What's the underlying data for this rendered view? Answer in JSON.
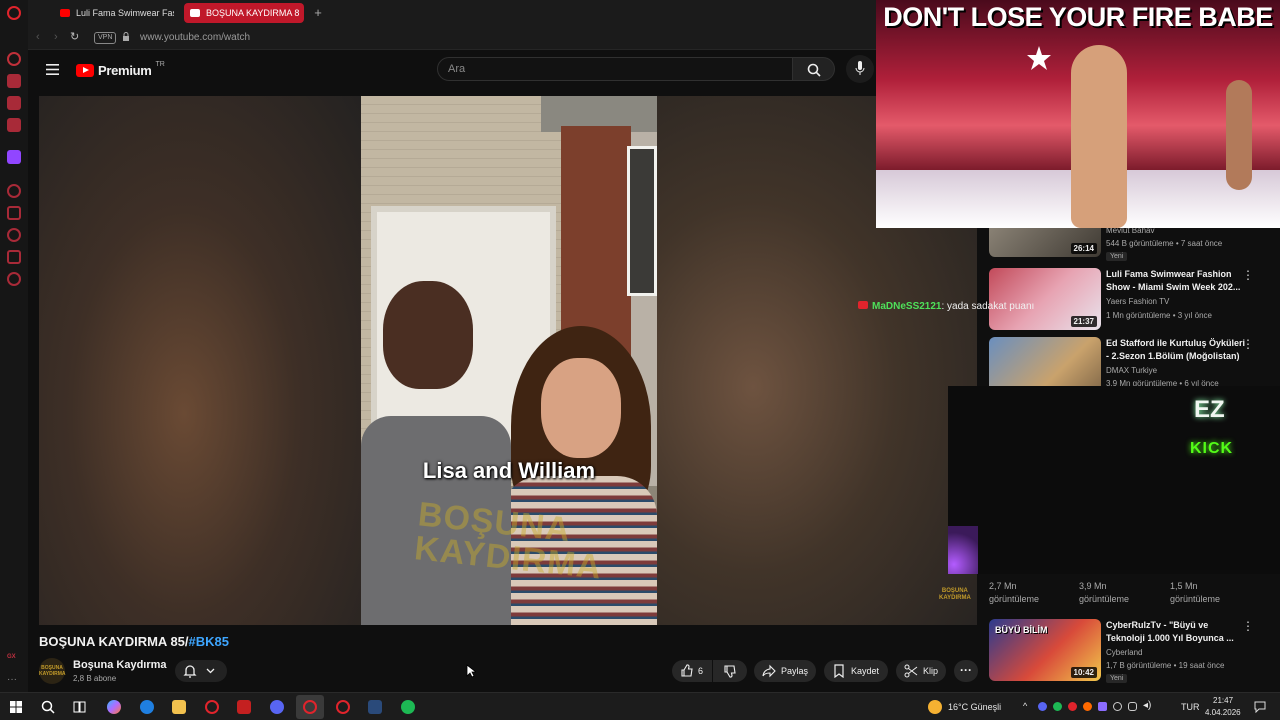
{
  "browser": {
    "tabs": [
      {
        "label": "Luli Fama Swimwear Fash"
      },
      {
        "label": "BOŞUNA KAYDIRMA 8"
      }
    ],
    "vpn_label": "VPN",
    "url": "www.youtube.com/watch"
  },
  "youtube": {
    "logo_text": "Premium",
    "logo_country": "TR",
    "search_placeholder": "Ara"
  },
  "video": {
    "caption": "Lisa and William",
    "watermark": "BOŞUNA KAYDIRMA",
    "title": "BOŞUNA KAYDIRMA 85/",
    "title_tag": "#BK85",
    "channel_name": "Boşuna Kaydırma",
    "channel_subs": "2,8 B abone",
    "channel_avatar_text": "BOŞUNA KAYDIRMA",
    "like_count": "6",
    "share_label": "Paylaş",
    "save_label": "Kaydet",
    "clip_label": "Klip"
  },
  "overlay": {
    "headline": "DON'T LOSE YOUR FIRE BABE",
    "kick_top": "EZ",
    "kick_bottom": "KICK",
    "chat_user": "MaDNeSS2121",
    "chat_text": ": yada sadakat puanı"
  },
  "recommendations": [
    {
      "duration": "26:14",
      "channel": "Mevlüt Bahav",
      "meta": "544 B görüntüleme • 7 saat önce",
      "badge": "Yeni"
    },
    {
      "title": "Luli Fama Swimwear Fashion Show - Miami Swim Week 202...",
      "duration": "21:37",
      "channel": "Yaers Fashion TV",
      "meta": "1 Mn görüntüleme • 3 yıl önce"
    },
    {
      "title": "Ed Stafford ile Kurtuluş Öyküleri - 2.Sezon 1.Bölüm (Moğolistan)",
      "channel": "DMAX Turkiye",
      "meta": "3,9 Mn görüntüleme • 6 yıl önce"
    },
    {
      "title": "CyberRulzTv - \"Büyü ve Teknoloji 1.000 Yıl Boyunca ...",
      "duration": "10:42",
      "channel": "Cyberland",
      "meta": "1,7 B görüntüleme • 19 saat önce",
      "badge": "Yeni",
      "thumb_text": "BÜYÜ BİLİM"
    }
  ],
  "shorts_stats": [
    {
      "views": "2,7 Mn",
      "label": "görüntüleme"
    },
    {
      "views": "3,9 Mn",
      "label": "görüntüleme"
    },
    {
      "views": "1,5 Mn",
      "label": "görüntüleme"
    }
  ],
  "taskbar": {
    "weather": "16°C  Güneşli",
    "lang": "TUR",
    "time": "21:47",
    "date": "4.04.2026"
  },
  "colors": {
    "youtube_red": "#ff0000",
    "opera_red": "#e0242c",
    "kick_green": "#53fc18",
    "link_blue": "#3ea6ff"
  }
}
